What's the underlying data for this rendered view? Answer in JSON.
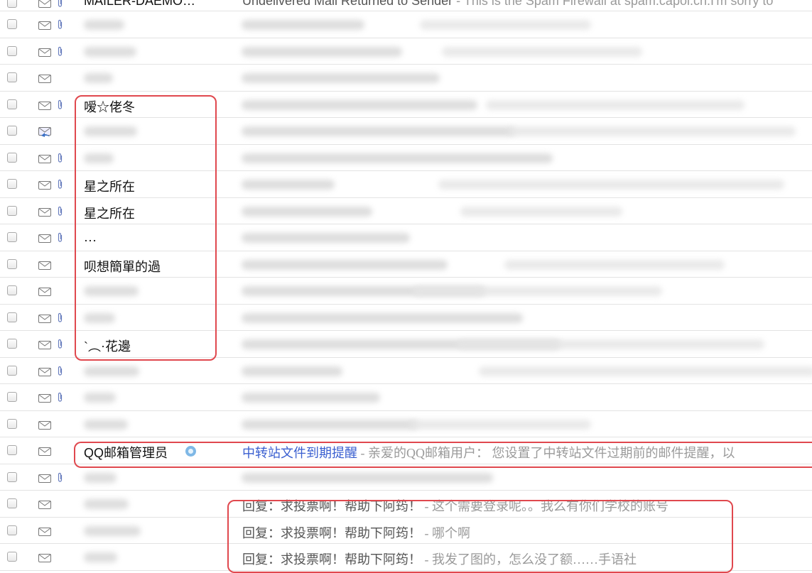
{
  "rows": [
    {
      "sender": "MAILER-DAEMO…",
      "subject": "Undelivered Mail Returned to Sender",
      "preview": " - This is the Spam Firewall at spam.capol.cn.I'm sorry to",
      "attach": true
    },
    {
      "sender": "",
      "subject": "",
      "preview": "",
      "attach": true
    },
    {
      "sender": "",
      "subject": "",
      "preview": "",
      "attach": true
    },
    {
      "sender": "",
      "subject": "",
      "preview": "",
      "attach": false
    },
    {
      "sender": "嗳☆佬冬",
      "subject": "",
      "preview": "",
      "attach": true
    },
    {
      "sender": "",
      "subject": "",
      "preview": "",
      "attach": false,
      "reply": true
    },
    {
      "sender": "",
      "subject": "",
      "preview": "",
      "attach": true
    },
    {
      "sender": "星之所在",
      "subject": "",
      "preview": "",
      "attach": true
    },
    {
      "sender": "星之所在",
      "subject": "",
      "preview": "",
      "attach": true
    },
    {
      "sender": "…",
      "subject": "",
      "preview": "",
      "attach": true
    },
    {
      "sender": "呗想簡單的過",
      "subject": "",
      "preview": "",
      "attach": false
    },
    {
      "sender": "",
      "subject": "",
      "preview": "",
      "attach": false
    },
    {
      "sender": "",
      "subject": "",
      "preview": "",
      "attach": true
    },
    {
      "sender": "`︵·花邊",
      "subject": "",
      "preview": "",
      "attach": true
    },
    {
      "sender": "",
      "subject": "",
      "preview": "",
      "attach": true
    },
    {
      "sender": "",
      "subject": "",
      "preview": "",
      "attach": true
    },
    {
      "sender": "",
      "subject": "",
      "preview": "",
      "attach": false
    },
    {
      "sender": "QQ邮箱管理员",
      "subject": "中转站文件到期提醒",
      "preview": " - 亲爱的QQ邮箱用户：        您设置了中转站文件过期前的邮件提醒，以",
      "attach": false,
      "qq": true
    },
    {
      "sender": "",
      "subject": "",
      "preview": "",
      "attach": true
    },
    {
      "sender": "",
      "subject": "回复：求投票啊！帮助下阿筠！",
      "preview": " - 这个需要登录呢。。我么有你们学校的账号",
      "attach": false
    },
    {
      "sender": "",
      "subject": "回复：求投票啊！帮助下阿筠！",
      "preview": " - 哪个啊",
      "attach": false
    },
    {
      "sender": "",
      "subject": "回复：求投票啊！帮助下阿筠！",
      "preview": " - 我发了图的，怎么没了额……手语社",
      "attach": false
    }
  ],
  "colors": {
    "highlight": "#e0484e",
    "link": "#3a5fd0"
  }
}
